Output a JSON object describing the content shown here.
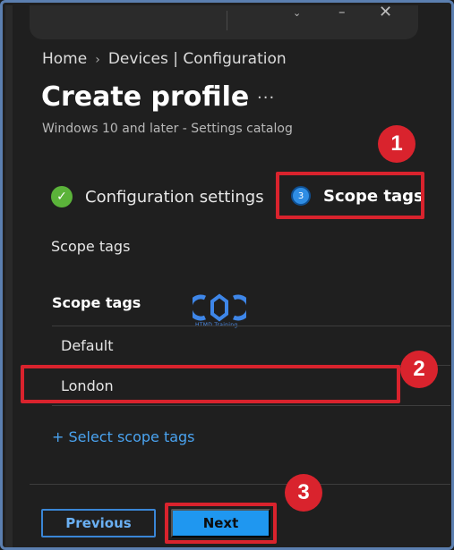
{
  "titlebar": {
    "chevron_icon": "chevron-down-icon",
    "minimize_icon": "minimize-icon",
    "close_icon": "close-icon"
  },
  "breadcrumb": {
    "items": [
      "Home",
      "Devices | Configuration"
    ],
    "separator": "›"
  },
  "page": {
    "title": "Create profile",
    "more": "···",
    "subtitle": "Windows 10 and later - Settings catalog"
  },
  "steps": [
    {
      "label": "Configuration settings",
      "icon": "checkmark-icon",
      "state": "completed"
    },
    {
      "label": "Scope tags",
      "number": "3",
      "state": "active"
    }
  ],
  "section": {
    "heading": "Scope tags"
  },
  "table": {
    "header": "Scope tags",
    "rows": [
      "Default",
      "London"
    ]
  },
  "logo": {
    "text": "HTMD Training",
    "icon": "htmd-logo-icon"
  },
  "select_link": "+ Select scope tags",
  "buttons": {
    "previous": "Previous",
    "next": "Next"
  },
  "annotations": {
    "badges": [
      "1",
      "2",
      "3"
    ],
    "color": "#d9232d"
  },
  "colors": {
    "accent": "#1f97f0",
    "link": "#4aa3f0",
    "success": "#5bb33a",
    "background": "#1f1f1f"
  }
}
